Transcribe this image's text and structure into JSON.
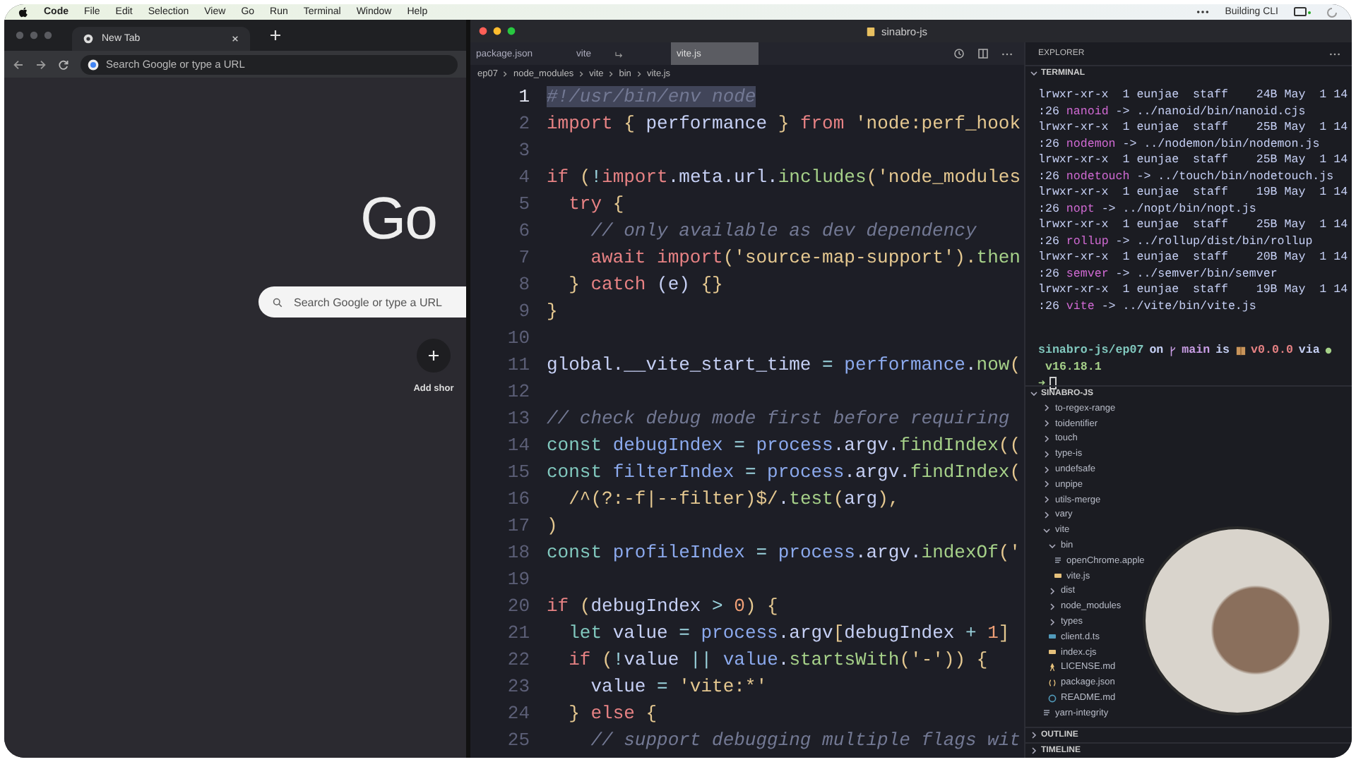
{
  "menu_bar": {
    "app": "Code",
    "items": [
      "File",
      "Edit",
      "Selection",
      "View",
      "Go",
      "Run",
      "Terminal",
      "Window",
      "Help"
    ],
    "status": "Building CLI"
  },
  "browser": {
    "tab": {
      "title": "New Tab"
    },
    "address_bar": {
      "placeholder": "Search Google or type a URL"
    },
    "logo": "Go",
    "search": {
      "placeholder": "Search Google or type a URL"
    },
    "shortcut": {
      "label": "Add shor"
    }
  },
  "editor": {
    "title": "sinabro-js",
    "tabs": [
      {
        "label": "package.json",
        "selected": false,
        "symlink": false
      },
      {
        "label": "vite",
        "selected": false,
        "symlink": true
      },
      {
        "label": "vite.js",
        "selected": true,
        "symlink": false
      }
    ],
    "breadcrumb": [
      "ep07",
      "node_modules",
      "vite",
      "bin",
      "vite.js"
    ],
    "lines": [
      {
        "number": "1",
        "selected": true,
        "tokens": [
          {
            "text": "#!/usr/bin/env node",
            "kind": "cmt"
          }
        ]
      },
      {
        "number": "2",
        "selected": false,
        "tokens": [
          {
            "text": "import",
            "kind": "kw"
          },
          {
            "text": " { ",
            "kind": "brace"
          },
          {
            "text": "performance",
            "kind": "plain"
          },
          {
            "text": " } ",
            "kind": "brace"
          },
          {
            "text": "from",
            "kind": "kw"
          },
          {
            "text": " 'node:perf_hook",
            "kind": "str"
          }
        ]
      },
      {
        "number": "3",
        "selected": false
      },
      {
        "number": "4",
        "selected": false,
        "tokens": [
          {
            "text": "if",
            "kind": "kw"
          },
          {
            "text": " (",
            "kind": "brace"
          },
          {
            "text": "!",
            "kind": "op"
          },
          {
            "text": "import",
            "kind": "kw"
          },
          {
            "text": ".meta.url.",
            "kind": "plain"
          },
          {
            "text": "includes",
            "kind": "fn"
          },
          {
            "text": "(",
            "kind": "brace"
          },
          {
            "text": "'node_modules",
            "kind": "str"
          }
        ]
      },
      {
        "number": "5",
        "selected": false,
        "tokens": [
          {
            "text": "  try",
            "kind": "kw"
          },
          {
            "text": " {",
            "kind": "brace"
          }
        ]
      },
      {
        "number": "6",
        "selected": false,
        "tokens": [
          {
            "text": "    // only available as dev dependency",
            "kind": "cmt"
          }
        ]
      },
      {
        "number": "7",
        "selected": false,
        "tokens": [
          {
            "text": "    await",
            "kind": "kw"
          },
          {
            "text": " import",
            "kind": "kw"
          },
          {
            "text": "(",
            "kind": "brace"
          },
          {
            "text": "'source-map-support'",
            "kind": "str"
          },
          {
            "text": ").",
            "kind": "brace"
          },
          {
            "text": "then",
            "kind": "fn"
          }
        ]
      },
      {
        "number": "8",
        "selected": false,
        "tokens": [
          {
            "text": "  } ",
            "kind": "brace"
          },
          {
            "text": "catch",
            "kind": "kw"
          },
          {
            "text": " (e) ",
            "kind": "plain"
          },
          {
            "text": "{}",
            "kind": "brace"
          }
        ]
      },
      {
        "number": "9",
        "selected": false,
        "tokens": [
          {
            "text": "}",
            "kind": "brace"
          }
        ]
      },
      {
        "number": "10",
        "selected": false
      },
      {
        "number": "11",
        "selected": false,
        "tokens": [
          {
            "text": "global.__vite_start_time",
            "kind": "plain"
          },
          {
            "text": " = ",
            "kind": "op"
          },
          {
            "text": "performance",
            "kind": "var"
          },
          {
            "text": ".",
            "kind": "plain"
          },
          {
            "text": "now",
            "kind": "fn"
          },
          {
            "text": "(",
            "kind": "brace"
          }
        ]
      },
      {
        "number": "12",
        "selected": false
      },
      {
        "number": "13",
        "selected": false,
        "tokens": [
          {
            "text": "// check debug mode first before requiring",
            "kind": "cmt"
          }
        ]
      },
      {
        "number": "14",
        "selected": false,
        "tokens": [
          {
            "text": "const",
            "kind": "decl"
          },
          {
            "text": " debugIndex",
            "kind": "var"
          },
          {
            "text": " = ",
            "kind": "op"
          },
          {
            "text": "process",
            "kind": "var"
          },
          {
            "text": ".argv.",
            "kind": "plain"
          },
          {
            "text": "findIndex",
            "kind": "fn"
          },
          {
            "text": "((",
            "kind": "brace"
          }
        ]
      },
      {
        "number": "15",
        "selected": false,
        "tokens": [
          {
            "text": "const",
            "kind": "decl"
          },
          {
            "text": " filterIndex",
            "kind": "var"
          },
          {
            "text": " = ",
            "kind": "op"
          },
          {
            "text": "process",
            "kind": "var"
          },
          {
            "text": ".argv.",
            "kind": "plain"
          },
          {
            "text": "findIndex",
            "kind": "fn"
          },
          {
            "text": "(",
            "kind": "brace"
          }
        ]
      },
      {
        "number": "16",
        "selected": false,
        "tokens": [
          {
            "text": "  /^(?:-f|--filter)$/",
            "kind": "str"
          },
          {
            "text": ".",
            "kind": "plain"
          },
          {
            "text": "test",
            "kind": "fn"
          },
          {
            "text": "(",
            "kind": "brace"
          },
          {
            "text": "arg",
            "kind": "plain"
          },
          {
            "text": "),",
            "kind": "brace"
          }
        ]
      },
      {
        "number": "17",
        "selected": false,
        "tokens": [
          {
            "text": ")",
            "kind": "brace"
          }
        ]
      },
      {
        "number": "18",
        "selected": false,
        "tokens": [
          {
            "text": "const",
            "kind": "decl"
          },
          {
            "text": " profileIndex",
            "kind": "var"
          },
          {
            "text": " = ",
            "kind": "op"
          },
          {
            "text": "process",
            "kind": "var"
          },
          {
            "text": ".argv.",
            "kind": "plain"
          },
          {
            "text": "indexOf",
            "kind": "fn"
          },
          {
            "text": "('",
            "kind": "brace"
          }
        ]
      },
      {
        "number": "19",
        "selected": false
      },
      {
        "number": "20",
        "selected": false,
        "tokens": [
          {
            "text": "if",
            "kind": "kw"
          },
          {
            "text": " (",
            "kind": "brace"
          },
          {
            "text": "debugIndex",
            "kind": "plain"
          },
          {
            "text": " > ",
            "kind": "op"
          },
          {
            "text": "0",
            "kind": "num"
          },
          {
            "text": ") {",
            "kind": "brace"
          }
        ]
      },
      {
        "number": "21",
        "selected": false,
        "tokens": [
          {
            "text": "  let",
            "kind": "decl"
          },
          {
            "text": " value",
            "kind": "plain"
          },
          {
            "text": " = ",
            "kind": "op"
          },
          {
            "text": "process",
            "kind": "var"
          },
          {
            "text": ".argv",
            "kind": "plain"
          },
          {
            "text": "[",
            "kind": "brace"
          },
          {
            "text": "debugIndex",
            "kind": "plain"
          },
          {
            "text": " + ",
            "kind": "op"
          },
          {
            "text": "1",
            "kind": "num"
          },
          {
            "text": "]",
            "kind": "brace"
          }
        ]
      },
      {
        "number": "22",
        "selected": false,
        "tokens": [
          {
            "text": "  if",
            "kind": "kw"
          },
          {
            "text": " (",
            "kind": "brace"
          },
          {
            "text": "!",
            "kind": "op"
          },
          {
            "text": "value",
            "kind": "plain"
          },
          {
            "text": " || ",
            "kind": "op"
          },
          {
            "text": "value",
            "kind": "var"
          },
          {
            "text": ".",
            "kind": "plain"
          },
          {
            "text": "startsWith",
            "kind": "fn"
          },
          {
            "text": "(",
            "kind": "brace"
          },
          {
            "text": "'-'",
            "kind": "str"
          },
          {
            "text": ")) {",
            "kind": "brace"
          }
        ]
      },
      {
        "number": "23",
        "selected": false,
        "tokens": [
          {
            "text": "    value",
            "kind": "plain"
          },
          {
            "text": " = ",
            "kind": "op"
          },
          {
            "text": "'vite:*'",
            "kind": "str"
          }
        ]
      },
      {
        "number": "24",
        "selected": false,
        "tokens": [
          {
            "text": "  } ",
            "kind": "brace"
          },
          {
            "text": "else",
            "kind": "kw"
          },
          {
            "text": " {",
            "kind": "brace"
          }
        ]
      },
      {
        "number": "25",
        "selected": false,
        "tokens": [
          {
            "text": "    // support debugging multiple flags wit",
            "kind": "cmt"
          }
        ]
      }
    ]
  },
  "sidebar": {
    "title": "EXPLORER",
    "terminal": {
      "title": "TERMINAL",
      "expanded": true,
      "lines": [
        [
          {
            "text": "lrwxr-xr-x  1 eunjae  staff    24B May  1 14",
            "kind": "plain"
          }
        ],
        [
          {
            "text": ":26 ",
            "kind": "plain"
          },
          {
            "text": "nanoid",
            "kind": "link"
          },
          {
            "text": " -> ../nanoid/bin/nanoid.cjs",
            "kind": "plain"
          }
        ],
        [
          {
            "text": "lrwxr-xr-x  1 eunjae  staff    25B May  1 14",
            "kind": "plain"
          }
        ],
        [
          {
            "text": ":26 ",
            "kind": "plain"
          },
          {
            "text": "nodemon",
            "kind": "link"
          },
          {
            "text": " -> ../nodemon/bin/nodemon.js",
            "kind": "plain"
          }
        ],
        [
          {
            "text": "lrwxr-xr-x  1 eunjae  staff    25B May  1 14",
            "kind": "plain"
          }
        ],
        [
          {
            "text": ":26 ",
            "kind": "plain"
          },
          {
            "text": "nodetouch",
            "kind": "link"
          },
          {
            "text": " -> ../touch/bin/nodetouch.js",
            "kind": "plain"
          }
        ],
        [
          {
            "text": "lrwxr-xr-x  1 eunjae  staff    19B May  1 14",
            "kind": "plain"
          }
        ],
        [
          {
            "text": ":26 ",
            "kind": "plain"
          },
          {
            "text": "nopt",
            "kind": "link"
          },
          {
            "text": " -> ../nopt/bin/nopt.js",
            "kind": "plain"
          }
        ],
        [
          {
            "text": "lrwxr-xr-x  1 eunjae  staff    25B May  1 14",
            "kind": "plain"
          }
        ],
        [
          {
            "text": ":26 ",
            "kind": "plain"
          },
          {
            "text": "rollup",
            "kind": "link"
          },
          {
            "text": " -> ../rollup/dist/bin/rollup",
            "kind": "plain"
          }
        ],
        [
          {
            "text": "lrwxr-xr-x  1 eunjae  staff    20B May  1 14",
            "kind": "plain"
          }
        ],
        [
          {
            "text": ":26 ",
            "kind": "plain"
          },
          {
            "text": "semver",
            "kind": "link"
          },
          {
            "text": " -> ../semver/bin/semver",
            "kind": "plain"
          }
        ],
        [
          {
            "text": "lrwxr-xr-x  1 eunjae  staff    19B May  1 14",
            "kind": "plain"
          }
        ],
        [
          {
            "text": ":26 ",
            "kind": "plain"
          },
          {
            "text": "vite",
            "kind": "link"
          },
          {
            "text": " -> ../vite/bin/vite.js",
            "kind": "plain"
          }
        ]
      ],
      "prompt": {
        "path": "sinabro-js/ep07",
        "on": "on",
        "branch": "main",
        "is": "is",
        "version": "v0.0.0",
        "via": "via",
        "node": "v16.18.1",
        "arrow": "➜"
      }
    },
    "project": {
      "title": "SINABRO-JS",
      "expanded": true,
      "tree": [
        {
          "label": "to-regex-range",
          "kind": "folder",
          "expanded": false
        },
        {
          "label": "toidentifier",
          "kind": "folder",
          "expanded": false
        },
        {
          "label": "touch",
          "kind": "folder",
          "expanded": false
        },
        {
          "label": "type-is",
          "kind": "folder",
          "expanded": false
        },
        {
          "label": "undefsafe",
          "kind": "folder",
          "expanded": false
        },
        {
          "label": "unpipe",
          "kind": "folder",
          "expanded": false
        },
        {
          "label": "utils-merge",
          "kind": "folder",
          "expanded": false
        },
        {
          "label": "vary",
          "kind": "folder",
          "expanded": false
        },
        {
          "label": "vite",
          "kind": "folder",
          "expanded": true,
          "children": [
            {
              "label": "bin",
              "kind": "folder",
              "expanded": true,
              "children": [
                {
                  "label": "openChrome.apple",
                  "kind": "text"
                },
                {
                  "label": "vite.js",
                  "kind": "js"
                }
              ]
            },
            {
              "label": "dist",
              "kind": "folder",
              "expanded": false
            },
            {
              "label": "node_modules",
              "kind": "folder",
              "expanded": false
            },
            {
              "label": "types",
              "kind": "folder",
              "expanded": false
            },
            {
              "label": "client.d.ts",
              "kind": "ts"
            },
            {
              "label": "index.cjs",
              "kind": "js"
            },
            {
              "label": "LICENSE.md",
              "kind": "license"
            },
            {
              "label": "package.json",
              "kind": "json"
            },
            {
              "label": "README.md",
              "kind": "info"
            }
          ]
        },
        {
          "label": "yarn-integrity",
          "kind": "text"
        }
      ]
    },
    "sections": [
      {
        "title": "OUTLINE",
        "expanded": false
      },
      {
        "title": "TIMELINE",
        "expanded": false
      }
    ]
  }
}
